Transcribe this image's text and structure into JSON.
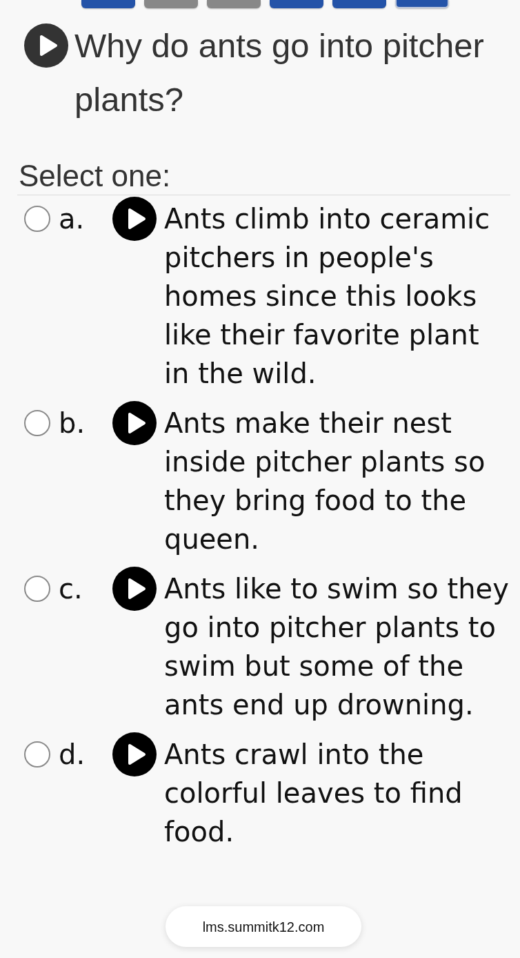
{
  "quiz_nav": [
    {
      "color": "#2453a8",
      "selected": false
    },
    {
      "color": "#888888",
      "selected": false
    },
    {
      "color": "#888888",
      "selected": false
    },
    {
      "color": "#2453a8",
      "selected": false
    },
    {
      "color": "#2453a8",
      "selected": false
    },
    {
      "color": "#2453a8",
      "selected": true
    }
  ],
  "question": {
    "text": "Why do ants go into pitcher plants?"
  },
  "prompt": "Select one:",
  "options": [
    {
      "letter": "a.",
      "text": "Ants climb into ceramic pitchers in people's homes since this looks like their favorite plant in the wild.",
      "selected": false
    },
    {
      "letter": "b.",
      "text": "Ants make their nest inside pitcher plants so they bring food to the queen.",
      "selected": false
    },
    {
      "letter": "c.",
      "text": "Ants like to swim so they go into pitcher plants to swim but some of the ants end up drowning.",
      "selected": false
    },
    {
      "letter": "d.",
      "text": "Ants crawl into the colorful leaves to find food.",
      "selected": false
    }
  ],
  "browser_bar": {
    "url": "lms.summitk12.com"
  }
}
